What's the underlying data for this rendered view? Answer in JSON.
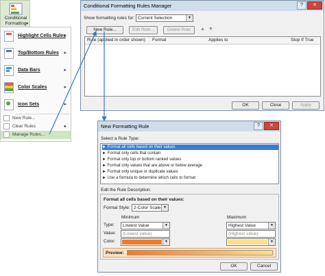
{
  "ribbon": {
    "button_label": "Conditional Formatting",
    "button_arrow": "▾"
  },
  "menu": {
    "items": [
      {
        "label": "Highlight Cells Rules",
        "icon": "highlight-cells-icon"
      },
      {
        "label": "Top/Bottom Rules",
        "icon": "top-bottom-icon"
      },
      {
        "label": "Data Bars",
        "icon": "data-bars-icon"
      },
      {
        "label": "Color Scales",
        "icon": "color-scales-icon"
      },
      {
        "label": "Icon Sets",
        "icon": "icon-sets-icon"
      }
    ],
    "new_rule": "New Rule...",
    "clear_rules": "Clear Rules",
    "manage_rules": "Manage Rules...",
    "submenu_arrow": "▸"
  },
  "manager": {
    "title": "Conditional Formatting Rules Manager",
    "show_label": "Show formatting rules for:",
    "show_value": "Current Selection",
    "new_rule": "New Rule...",
    "edit_rule": "Edit Rule...",
    "delete_rule": "Delete Rule",
    "columns": [
      "Rule (applied in order shown)",
      "Format",
      "Applies to",
      "Stop If True"
    ],
    "ok": "OK",
    "close": "Close",
    "apply": "Apply",
    "title_buttons": {
      "help": "?",
      "close": "✕"
    }
  },
  "new_rule": {
    "title": "New Formatting Rule",
    "select_type_label": "Select a Rule Type:",
    "rule_types": [
      "Format all cells based on their values",
      "Format only cells that contain",
      "Format only top or bottom ranked values",
      "Format only values that are above or below average",
      "Format only unique or duplicate values",
      "Use a formula to determine which cells to format"
    ],
    "edit_desc_label": "Edit the Rule Description:",
    "format_all_label": "Format all cells based on their values:",
    "format_style_label": "Format Style:",
    "format_style_value": "2-Color Scale",
    "minimum_label": "Minimum",
    "maximum_label": "Maximum",
    "type_label": "Type:",
    "value_label": "Value:",
    "color_label": "Color:",
    "min_type": "Lowest Value",
    "max_type": "Highest Value",
    "min_value": "(Lowest value)",
    "max_value": "(Highest value)",
    "min_color": "#f07b2a",
    "max_color": "#fbe08a",
    "preview_label": "Preview:",
    "ok": "OK",
    "cancel": "Cancel",
    "title_buttons": {
      "help": "?",
      "close": "✕"
    }
  }
}
